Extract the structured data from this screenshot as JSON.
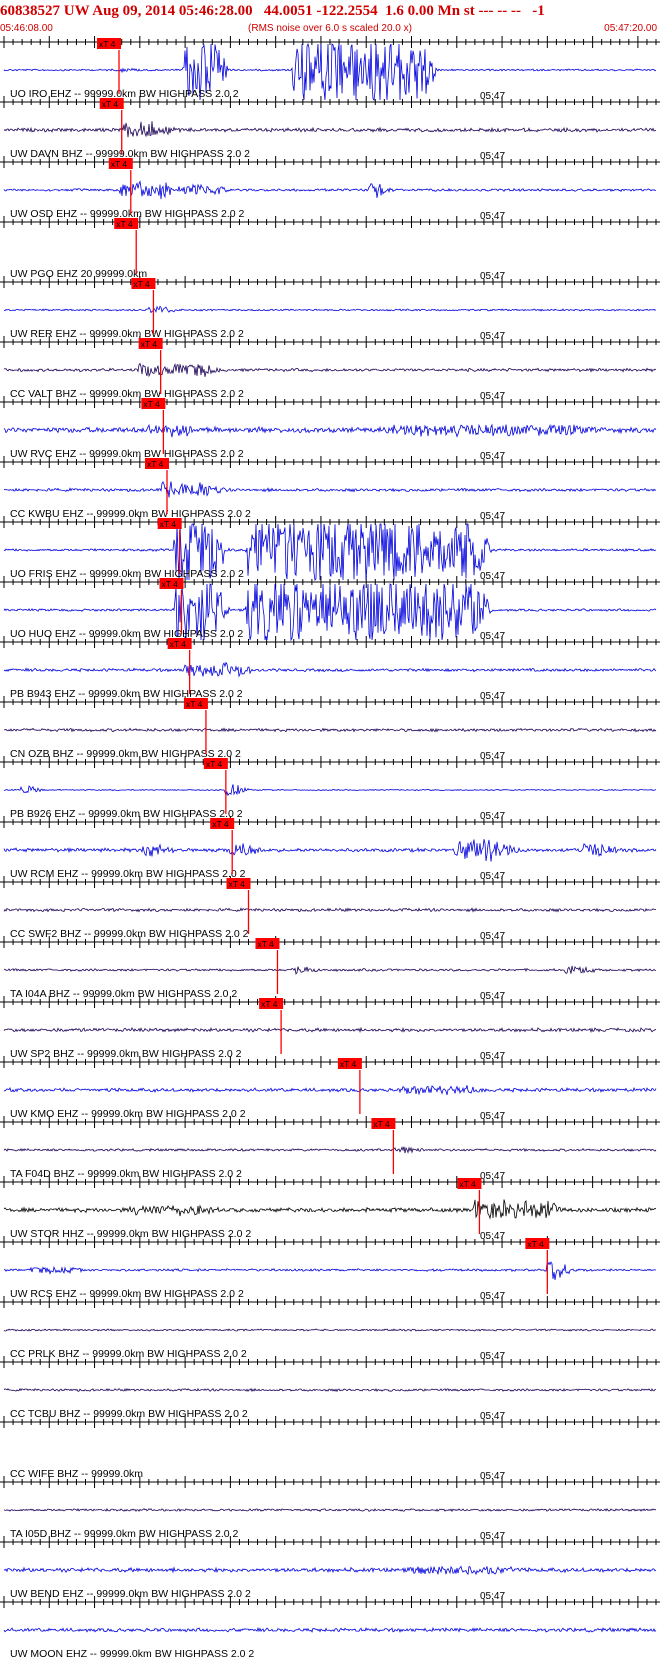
{
  "header": {
    "title": "60838527 UW Aug 09, 2014 05:46:28.00   44.0051 -122.2554  1.6 0.00 Mn st --- -- --   -1",
    "start_time": "05:46:08.00",
    "note": "(RMS noise over 6.0 s scaled 20.0 x)",
    "end_time": "05:47:20.00"
  },
  "colors": {
    "header_text": "#d00000",
    "pick": "#ff0000",
    "trace_blue": "#0000dd",
    "trace_dark": "#1a0055",
    "trace_black": "#000000",
    "axis": "#000000"
  },
  "chart_data": {
    "type": "seismogram",
    "time_range": [
      "05:46:08.00",
      "05:47:20.00"
    ],
    "minute_label": "05:47",
    "pick_label": "xT 4",
    "traces": [
      {
        "label": "UO IRO EHZ -- 99999.0km BW  HIGHPASS  2.0  2",
        "color": "#0000dd",
        "pick_s": 12.7,
        "amp": 0.15,
        "bursts": [
          [
            12.7,
            0.9,
            0.3
          ],
          [
            20,
            3,
            8
          ],
          [
            32,
            14,
            9
          ]
        ]
      },
      {
        "label": "UW DAVN BHZ -- 99999.0km BW  HIGHPASS  2.0  2",
        "color": "#1a0055",
        "pick_s": 13.0,
        "amp": 0.3,
        "bursts": [
          [
            13,
            4,
            1.6
          ]
        ]
      },
      {
        "label": "UW OSD EHZ -- 99999.0km BW  HIGHPASS  2.0  2",
        "color": "#0000dd",
        "pick_s": 14.0,
        "amp": 0.2,
        "bursts": [
          [
            13,
            5,
            1.8
          ],
          [
            20,
            3,
            1.2
          ],
          [
            40.5,
            0.6,
            2.5
          ]
        ]
      },
      {
        "label": "UW PGO EHZ 20 99999.0km",
        "color": "#000000",
        "pick_s": 14.6,
        "amp": 0,
        "bursts": []
      },
      {
        "label": "UW RER EHZ -- 99999.0km BW  HIGHPASS  2.0  2",
        "color": "#0000dd",
        "pick_s": 16.5,
        "amp": 0.15,
        "bursts": [
          [
            16,
            2,
            0.6
          ]
        ]
      },
      {
        "label": "CC VALT BHZ -- 99999.0km BW  HIGHPASS  2.0  2",
        "color": "#1a0055",
        "pick_s": 17.3,
        "amp": 0.25,
        "bursts": [
          [
            15,
            7,
            1.3
          ]
        ]
      },
      {
        "label": "UW RVC EHZ -- 99999.0km BW  HIGHPASS  2.0  2",
        "color": "#0000dd",
        "pick_s": 17.6,
        "amp": 0.45,
        "bursts": [
          [
            16,
            4,
            0.9
          ],
          [
            43,
            20,
            0.9
          ]
        ]
      },
      {
        "label": "CC KWBU EHZ -- 99999.0km BW  HIGHPASS  2.0  2",
        "color": "#0000dd",
        "pick_s": 18.0,
        "amp": 0.25,
        "bursts": [
          [
            17.5,
            5,
            1.6
          ]
        ]
      },
      {
        "label": "UO FRIS EHZ -- 99999.0km BW  HIGHPASS  2.0  2",
        "color": "#0000dd",
        "pick_s": 19.4,
        "amp": 0.2,
        "bursts": [
          [
            19,
            4,
            8
          ],
          [
            27,
            25,
            8
          ]
        ]
      },
      {
        "label": "UO HUO EHZ -- 99999.0km BW  HIGHPASS  2.0  2",
        "color": "#0000dd",
        "pick_s": 19.6,
        "amp": 0.2,
        "bursts": [
          [
            19,
            4,
            8
          ],
          [
            27,
            25,
            8
          ]
        ]
      },
      {
        "label": "PB B943 EHZ -- 99999.0km BW  HIGHPASS  2.0  2",
        "color": "#0000dd",
        "pick_s": 20.5,
        "amp": 0.25,
        "bursts": [
          [
            20,
            6,
            1.4
          ]
        ]
      },
      {
        "label": "CN OZB BHZ -- 99999.0km BW  HIGHPASS  2.0  2",
        "color": "#1a0055",
        "pick_s": 22.3,
        "amp": 0.25,
        "bursts": []
      },
      {
        "label": "PB B926 EHZ -- 99999.0km BW  HIGHPASS  2.0  2",
        "color": "#0000dd",
        "pick_s": 24.5,
        "amp": 0.1,
        "bursts": [
          [
            2,
            0.4,
            1.2
          ],
          [
            24.5,
            0.8,
            1.4
          ]
        ]
      },
      {
        "label": "UW RCM EHZ -- 99999.0km BW  HIGHPASS  2.0  2",
        "color": "#0000dd",
        "pick_s": 25.2,
        "amp": 0.3,
        "bursts": [
          [
            15.5,
            1.5,
            1.2
          ],
          [
            25,
            2,
            1.2
          ],
          [
            50,
            5,
            2.2
          ],
          [
            64,
            2,
            1.4
          ]
        ]
      },
      {
        "label": "CC SWF2 BHZ -- 99999.0km BW  HIGHPASS  2.0  2",
        "color": "#1a0055",
        "pick_s": 27.0,
        "amp": 0.25,
        "bursts": []
      },
      {
        "label": "TA I04A BHZ -- 99999.0km BW  HIGHPASS  2.0  2",
        "color": "#1a0055",
        "pick_s": 30.2,
        "amp": 0.2,
        "bursts": [
          [
            32,
            1,
            0.8
          ],
          [
            62,
            2,
            0.6
          ]
        ]
      },
      {
        "label": "UW SP2 BHZ -- 99999.0km BW  HIGHPASS  2.0  2",
        "color": "#1a0055",
        "pick_s": 30.6,
        "amp": 0.3,
        "bursts": []
      },
      {
        "label": "UW KMO EHZ -- 99999.0km BW  HIGHPASS  2.0  2",
        "color": "#0000dd",
        "pick_s": 39.3,
        "amp": 0.3,
        "bursts": [
          [
            44,
            7,
            0.7
          ]
        ]
      },
      {
        "label": "TA F04D BHZ -- 99999.0km BW  HIGHPASS  2.0  2",
        "color": "#1a0055",
        "pick_s": 43.0,
        "amp": 0.2,
        "bursts": [
          [
            43,
            1.5,
            0.6
          ]
        ]
      },
      {
        "label": "UW STOR HHZ -- 99999.0km BW  HIGHPASS  2.0  2",
        "color": "#000000",
        "pick_s": 52.5,
        "amp": 0.35,
        "bursts": [
          [
            14,
            8,
            0.8
          ],
          [
            52,
            8,
            1.9
          ]
        ]
      },
      {
        "label": "UW RCS EHZ -- 99999.0km BW  HIGHPASS  2.0  2",
        "color": "#0000dd",
        "pick_s": 60.0,
        "amp": 0.2,
        "bursts": [
          [
            3,
            4,
            0.5
          ],
          [
            60,
            1,
            2.4
          ]
        ]
      },
      {
        "label": "CC PRLK BHZ -- 99999.0km BW  HIGHPASS  2.0  2",
        "color": "#1a0055",
        "pick_s": null,
        "amp": 0.15,
        "bursts": []
      },
      {
        "label": "CC TCBU BHZ -- 99999.0km BW  HIGHPASS  2.0  2",
        "color": "#1a0055",
        "pick_s": null,
        "amp": 0.2,
        "bursts": []
      },
      {
        "label": "CC WIFE BHZ -- 99999.0km",
        "color": "#000000",
        "pick_s": null,
        "amp": 0,
        "bursts": []
      },
      {
        "label": "TA I05D BHZ -- 99999.0km BW  HIGHPASS  2.0  2",
        "color": "#1a0055",
        "pick_s": null,
        "amp": 0.2,
        "bursts": []
      },
      {
        "label": "UW BEND EHZ -- 99999.0km BW  HIGHPASS  2.0  2",
        "color": "#0000dd",
        "pick_s": null,
        "amp": 0.35,
        "bursts": [
          [
            45,
            10,
            0.6
          ]
        ]
      },
      {
        "label": "UW MOON EHZ -- 99999.0km BW  HIGHPASS  2.0  2",
        "color": "#0000dd",
        "pick_s": null,
        "amp": 0.3,
        "bursts": []
      }
    ]
  }
}
